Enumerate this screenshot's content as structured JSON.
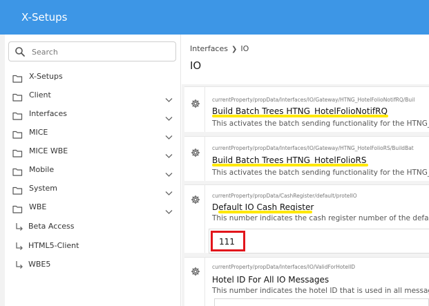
{
  "app": {
    "title": "X-Setups"
  },
  "search": {
    "placeholder": "Search"
  },
  "sidebar": {
    "items": [
      {
        "label": "X-Setups",
        "icon": "folder-icon",
        "expandable": false
      },
      {
        "label": "Client",
        "icon": "folder-icon",
        "expandable": true
      },
      {
        "label": "Interfaces",
        "icon": "folder-icon",
        "expandable": true
      },
      {
        "label": "MICE",
        "icon": "folder-icon",
        "expandable": true
      },
      {
        "label": "MICE WBE",
        "icon": "folder-icon",
        "expandable": true
      },
      {
        "label": "Mobile",
        "icon": "folder-icon",
        "expandable": true
      },
      {
        "label": "System",
        "icon": "folder-icon",
        "expandable": true
      },
      {
        "label": "WBE",
        "icon": "folder-icon",
        "expandable": true
      },
      {
        "label": "Beta Access",
        "icon": "subdirectory-arrow-icon",
        "expandable": false
      },
      {
        "label": "HTML5-Client",
        "icon": "subdirectory-arrow-icon",
        "expandable": false
      },
      {
        "label": "WBE5",
        "icon": "subdirectory-arrow-icon",
        "expandable": false
      }
    ]
  },
  "breadcrumb": {
    "items": [
      "Interfaces",
      "IO"
    ]
  },
  "page": {
    "title": "IO"
  },
  "settings": [
    {
      "path": "currentProperty/propData/Interfaces/IO/Gateway/HTNG_HotelFolioNotifRQ/Buil",
      "title": "Build Batch Trees HTNG_HotelFolioNotifRQ",
      "description": "This activates the batch sending functionality for the HTNG_H"
    },
    {
      "path": "currentProperty/propData/Interfaces/IO/Gateway/HTNG_HotelFolioRS/BuildBat",
      "title": "Build Batch Trees HTNG_HotelFolioRS",
      "description": "This activates the batch sending functionality for the HTNG_H"
    },
    {
      "path": "currentProperty/propData/CashRegister/default/protelIO",
      "title": "Default IO Cash Register",
      "description": "This number indicates the cash register number of the default",
      "value": "111"
    },
    {
      "path": "currentProperty/propData/Interfaces/IO/ValidForHotelID",
      "title": "Hotel ID For All IO Messages",
      "description": "This number indicates the hotel ID that is used in all messages"
    }
  ],
  "colors": {
    "topbar": "#3d96e6",
    "highlight": "#ffe800",
    "focus_outline": "#e2151b"
  }
}
